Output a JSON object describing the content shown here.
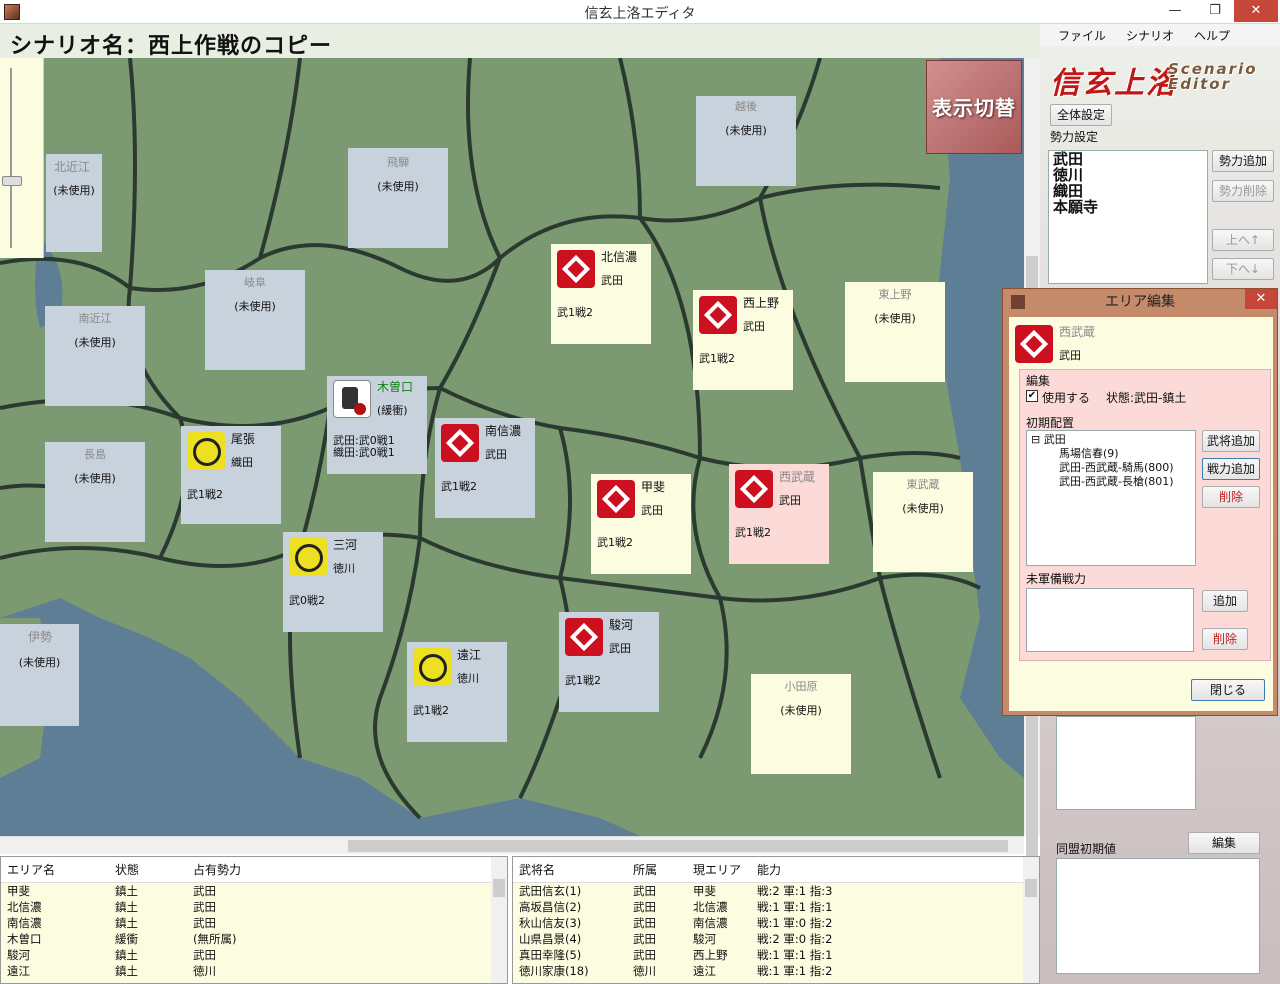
{
  "window": {
    "title": "信玄上洛エディタ",
    "min": "—",
    "max": "❐",
    "close": "✕"
  },
  "scenario": {
    "label": "シナリオ名：西上作戦のコピー"
  },
  "map": {
    "toggle_label": "表示切替",
    "areas": [
      {
        "key": "kitaomi",
        "name": "北近江",
        "owner": "",
        "status": "(未使用)",
        "style": "gray"
      },
      {
        "key": "hida",
        "name": "飛騨",
        "owner": "",
        "status": "(未使用)",
        "style": "gray"
      },
      {
        "key": "echigo",
        "name": "越後",
        "owner": "",
        "status": "(未使用)",
        "style": "gray"
      },
      {
        "key": "gifu",
        "name": "岐阜",
        "owner": "",
        "status": "(未使用)",
        "style": "gray"
      },
      {
        "key": "minamiomi",
        "name": "南近江",
        "owner": "",
        "status": "(未使用)",
        "style": "gray"
      },
      {
        "key": "nagashima",
        "name": "長島",
        "owner": "",
        "status": "(未使用)",
        "style": "gray"
      },
      {
        "key": "ise",
        "name": "伊勢",
        "owner": "",
        "status": "(未使用)",
        "style": "gray"
      },
      {
        "key": "kitashinano",
        "name": "北信濃",
        "owner": "武田",
        "status": "武1戦2",
        "style": "cream",
        "mon": "red"
      },
      {
        "key": "nishikozuke",
        "name": "西上野",
        "owner": "武田",
        "status": "武1戦2",
        "style": "cream",
        "mon": "red"
      },
      {
        "key": "higashikozuke",
        "name": "東上野",
        "owner": "",
        "status": "(未使用)",
        "style": "cream"
      },
      {
        "key": "kisoguchi",
        "name": "木曽口",
        "owner": "(緩衝)",
        "status": "武田:武0戦1",
        "status2": "織田:武0戦1",
        "style": "gray",
        "mon": "kiso"
      },
      {
        "key": "owari",
        "name": "尾張",
        "owner": "織田",
        "status": "武1戦2",
        "style": "gray",
        "mon": "yel"
      },
      {
        "key": "minamishinano",
        "name": "南信濃",
        "owner": "武田",
        "status": "武1戦2",
        "style": "gray",
        "mon": "red"
      },
      {
        "key": "kai",
        "name": "甲斐",
        "owner": "武田",
        "status": "武1戦2",
        "style": "cream",
        "mon": "red"
      },
      {
        "key": "nishimusashi",
        "name": "西武蔵",
        "owner": "武田",
        "status": "武1戦2",
        "style": "pink",
        "mon": "red"
      },
      {
        "key": "higashimusashi",
        "name": "東武蔵",
        "owner": "",
        "status": "(未使用)",
        "style": "cream"
      },
      {
        "key": "mikawa",
        "name": "三河",
        "owner": "徳川",
        "status": "武0戦2",
        "style": "gray",
        "mon": "yel"
      },
      {
        "key": "suruga",
        "name": "駿河",
        "owner": "武田",
        "status": "武1戦2",
        "style": "gray",
        "mon": "red"
      },
      {
        "key": "totomi",
        "name": "遠江",
        "owner": "徳川",
        "status": "武1戦2",
        "style": "gray",
        "mon": "yel"
      },
      {
        "key": "odawara",
        "name": "小田原",
        "owner": "",
        "status": "(未使用)",
        "style": "cream"
      }
    ]
  },
  "menu": {
    "file": "ファイル",
    "scenario": "シナリオ",
    "help": "ヘルプ"
  },
  "logo": {
    "main": "信玄上洛",
    "sub": "Scenario Editor"
  },
  "sidebar": {
    "global_settings": "全体設定",
    "force_settings_label": "勢力設定",
    "forces": [
      "武田",
      "徳川",
      "織田",
      "本願寺"
    ],
    "add_force": "勢力追加",
    "remove_force": "勢力削除",
    "move_up": "上へ↑",
    "move_down": "下へ↓",
    "alliance_label": "同盟初期値",
    "edit": "編集"
  },
  "dialog": {
    "title": "エリア編集",
    "area_name": "西武蔵",
    "owner": "武田",
    "section_edit": "編集",
    "use_label": "使用する",
    "state": "状態:武田-鎮土",
    "initial_label": "初期配置",
    "tree_root": "武田",
    "tree_items": [
      "馬場信春(9)",
      "武田-西武蔵-騎馬(800)",
      "武田-西武蔵-長槍(801)"
    ],
    "add_general": "武将追加",
    "add_force": "戦力追加",
    "delete": "削除",
    "unassigned_label": "未軍備戦力",
    "add": "追加",
    "delete2": "削除",
    "close": "閉じる"
  },
  "area_table": {
    "headers": [
      "エリア名",
      "状態",
      "占有勢力"
    ],
    "rows": [
      [
        "甲斐",
        "鎮土",
        "武田"
      ],
      [
        "北信濃",
        "鎮土",
        "武田"
      ],
      [
        "南信濃",
        "鎮土",
        "武田"
      ],
      [
        "木曽口",
        "緩衝",
        "(無所属)"
      ],
      [
        "駿河",
        "鎮土",
        "武田"
      ],
      [
        "遠江",
        "鎮土",
        "徳川"
      ]
    ]
  },
  "general_table": {
    "headers": [
      "武将名",
      "所属",
      "現エリア",
      "能力"
    ],
    "rows": [
      [
        "武田信玄(1)",
        "武田",
        "甲斐",
        "戦:2 軍:1 指:3"
      ],
      [
        "高坂昌信(2)",
        "武田",
        "北信濃",
        "戦:1 軍:1 指:1"
      ],
      [
        "秋山信友(3)",
        "武田",
        "南信濃",
        "戦:1 軍:0 指:2"
      ],
      [
        "山県昌景(4)",
        "武田",
        "駿河",
        "戦:2 軍:0 指:2"
      ],
      [
        "真田幸隆(5)",
        "武田",
        "西上野",
        "戦:1 軍:1 指:1"
      ],
      [
        "徳川家康(18)",
        "徳川",
        "遠江",
        "戦:1 軍:1 指:2"
      ]
    ]
  },
  "colors": {
    "land": "#7b9a72",
    "sea": "#5d7e95",
    "border": "#2a3a30",
    "accent": "#cc1020"
  }
}
